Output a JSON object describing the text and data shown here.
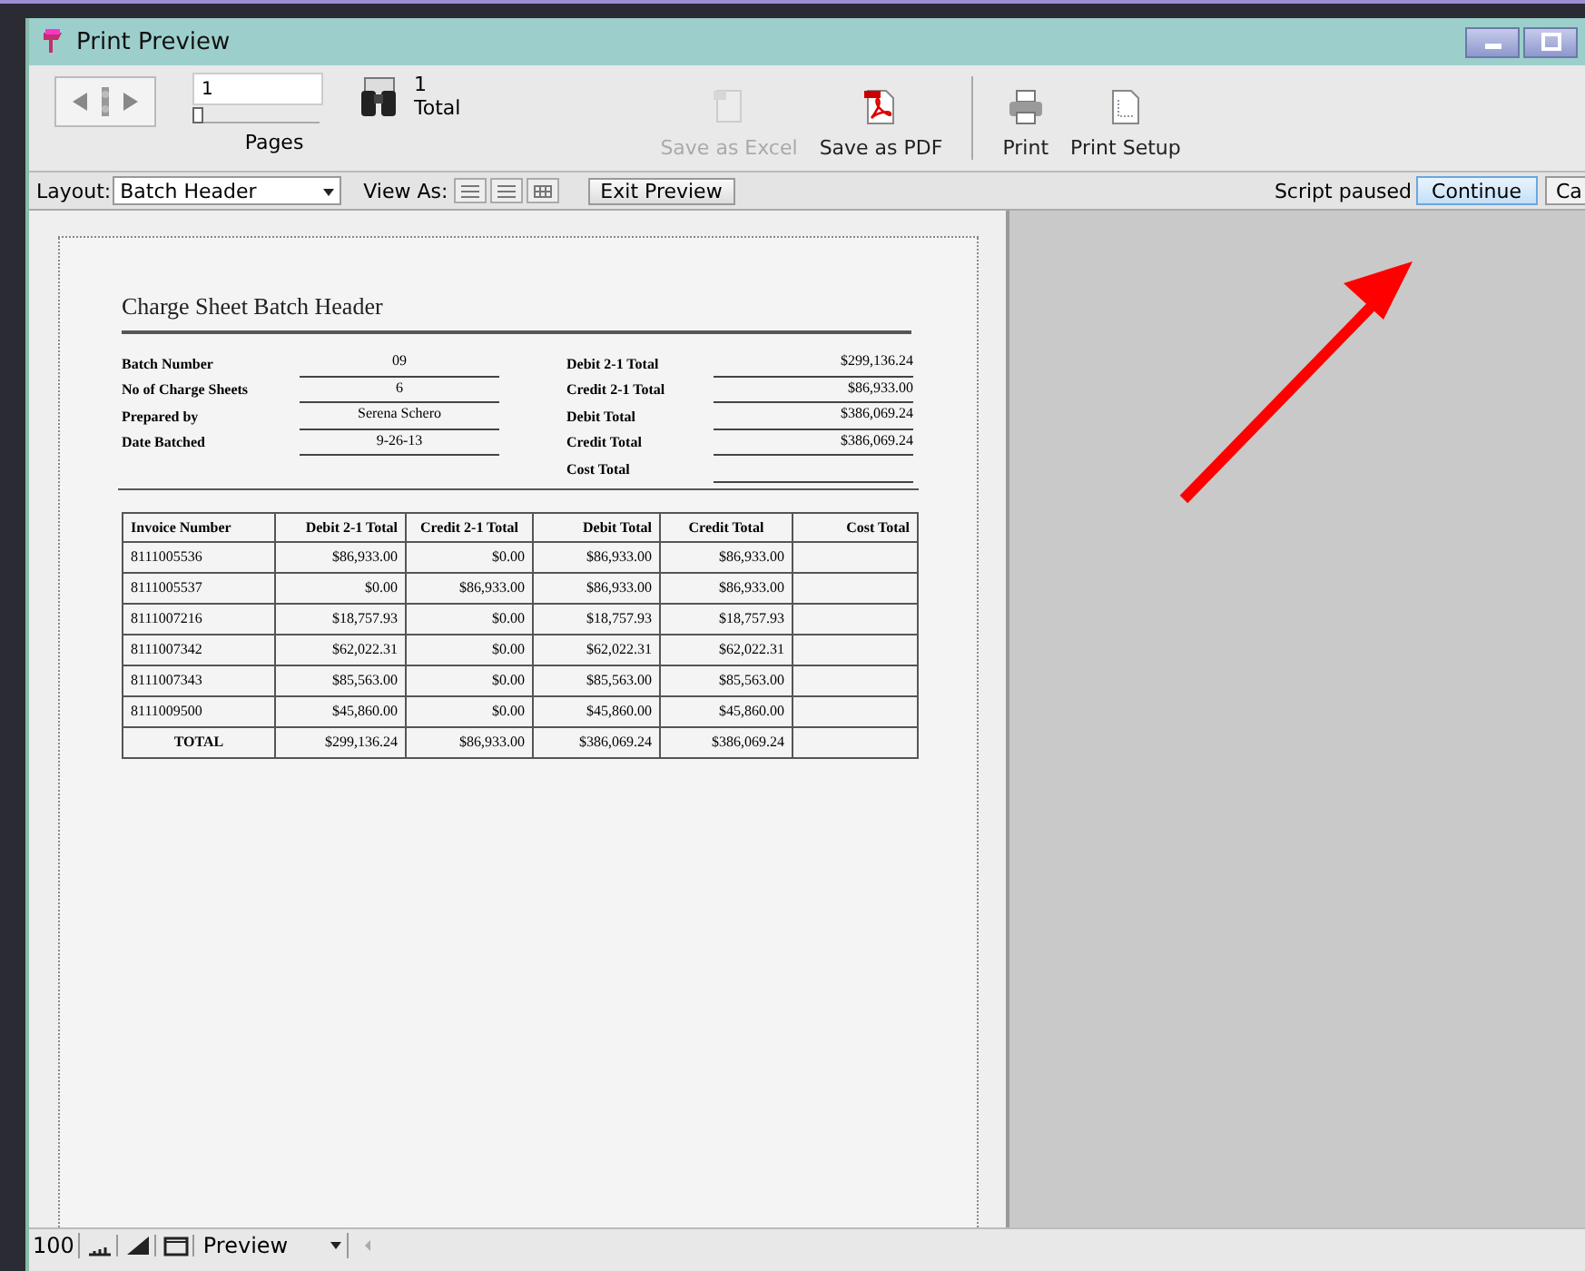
{
  "window": {
    "title": "Print Preview"
  },
  "toolbar": {
    "page_field": {
      "value": "1"
    },
    "page_slider": {
      "level": 0
    },
    "pages_label": "Pages",
    "total_count": "1",
    "total_label": "Total",
    "buttons": [
      {
        "label": "Save as Excel",
        "kind": "excel",
        "disabled": true
      },
      {
        "label": "Save as PDF",
        "kind": "pdf",
        "disabled": false
      },
      {
        "label": "Print",
        "kind": "print",
        "disabled": false
      },
      {
        "label": "Print Setup",
        "kind": "setup",
        "disabled": false
      }
    ]
  },
  "layout_bar": {
    "layout_label": "Layout:",
    "layout_value": "Batch Header",
    "view_as_label": "View As:",
    "exit_button": "Exit Preview",
    "script_status": "Script paused",
    "continue_button": "Continue",
    "cancel_button": "Ca"
  },
  "report": {
    "title": "Charge Sheet Batch Header",
    "left_fields": [
      {
        "label": "Batch Number",
        "value": "09"
      },
      {
        "label": "No of Charge Sheets",
        "value": "6"
      },
      {
        "label": "Prepared by",
        "value": "Serena Schero"
      },
      {
        "label": "Date Batched",
        "value": "9-26-13"
      }
    ],
    "right_fields": [
      {
        "label": "Debit 2-1 Total",
        "value": "$299,136.24"
      },
      {
        "label": "Credit 2-1 Total",
        "value": "$86,933.00"
      },
      {
        "label": "Debit Total",
        "value": "$386,069.24"
      },
      {
        "label": "Credit Total",
        "value": "$386,069.24"
      },
      {
        "label": "Cost Total"
      }
    ],
    "table": {
      "columns": [
        "Invoice Number",
        "Debit 2-1 Total",
        "Credit 2-1 Total",
        "Debit Total",
        "Credit Total",
        "Cost Total"
      ],
      "rows": [
        [
          "8111005536",
          "$86,933.00",
          "$0.00",
          "$86,933.00",
          "$86,933.00"
        ],
        [
          "8111005537",
          "$0.00",
          "$86,933.00",
          "$86,933.00",
          "$86,933.00"
        ],
        [
          "8111007216",
          "$18,757.93",
          "$0.00",
          "$18,757.93",
          "$18,757.93"
        ],
        [
          "8111007342",
          "$62,022.31",
          "$0.00",
          "$62,022.31",
          "$62,022.31"
        ],
        [
          "8111007343",
          "$85,563.00",
          "$0.00",
          "$85,563.00",
          "$85,563.00"
        ],
        [
          "8111009500",
          "$45,860.00",
          "$0.00",
          "$45,860.00",
          "$45,860.00"
        ]
      ],
      "total_row": [
        "TOTAL",
        "$299,136.24",
        "$86,933.00",
        "$386,069.24",
        "$386,069.24"
      ]
    }
  },
  "status_bar": {
    "zoom": "100",
    "mode": "Preview"
  }
}
